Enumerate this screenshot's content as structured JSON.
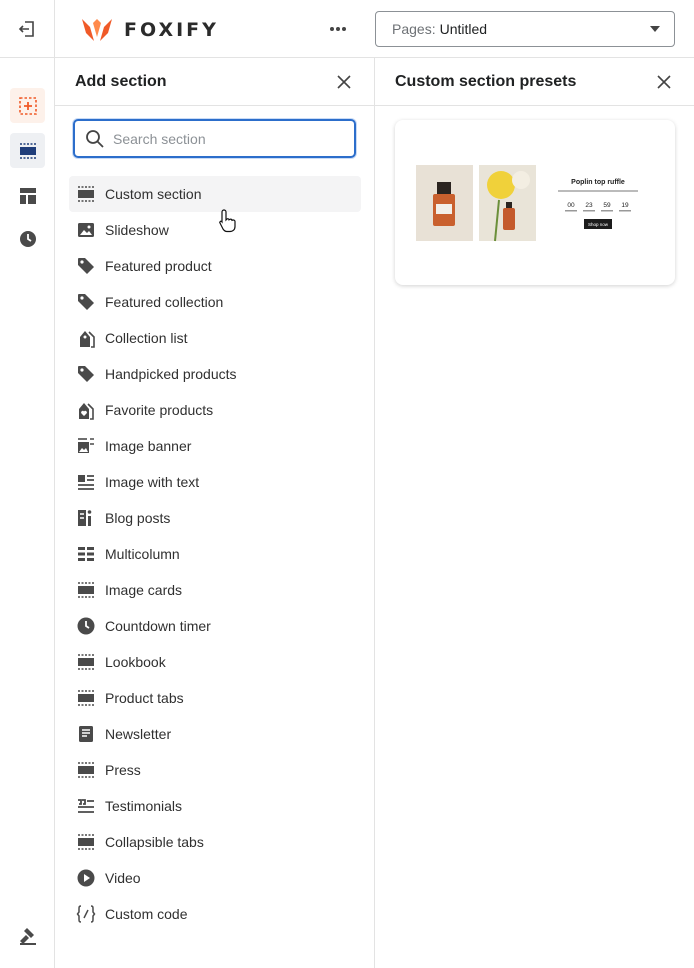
{
  "topbar": {
    "brand": "FOXIFY",
    "pages_prefix": "Pages:",
    "pages_value": "Untitled"
  },
  "rail": {
    "icons": [
      "add-section-icon",
      "section-icon",
      "layout-icon",
      "history-icon",
      "tools-icon"
    ]
  },
  "add_panel": {
    "title": "Add section",
    "search_placeholder": "Search section",
    "items": [
      {
        "label": "Custom section",
        "icon": "section-icon"
      },
      {
        "label": "Slideshow",
        "icon": "image-icon"
      },
      {
        "label": "Featured product",
        "icon": "tag-icon"
      },
      {
        "label": "Featured collection",
        "icon": "tag-icon"
      },
      {
        "label": "Collection list",
        "icon": "tags-icon"
      },
      {
        "label": "Handpicked products",
        "icon": "tag-icon"
      },
      {
        "label": "Favorite products",
        "icon": "heart-tag-icon"
      },
      {
        "label": "Image banner",
        "icon": "image-banner-icon"
      },
      {
        "label": "Image with text",
        "icon": "image-text-icon"
      },
      {
        "label": "Blog posts",
        "icon": "blog-icon"
      },
      {
        "label": "Multicolumn",
        "icon": "columns-icon"
      },
      {
        "label": "Image cards",
        "icon": "section-icon"
      },
      {
        "label": "Countdown timer",
        "icon": "clock-icon"
      },
      {
        "label": "Lookbook",
        "icon": "section-icon"
      },
      {
        "label": "Product tabs",
        "icon": "section-icon"
      },
      {
        "label": "Newsletter",
        "icon": "newsletter-icon"
      },
      {
        "label": "Press",
        "icon": "section-icon"
      },
      {
        "label": "Testimonials",
        "icon": "quote-icon"
      },
      {
        "label": "Collapsible tabs",
        "icon": "section-icon"
      },
      {
        "label": "Video",
        "icon": "play-icon"
      },
      {
        "label": "Custom code",
        "icon": "code-icon"
      }
    ]
  },
  "presets_panel": {
    "title": "Custom section presets",
    "preset": {
      "heading": "Poplin top ruffle",
      "timer": {
        "days": "00",
        "hours": "23",
        "mins": "59",
        "secs": "19"
      },
      "button": "Shop now"
    }
  },
  "colors": {
    "accent": "#f05a28",
    "focus": "#2c6ecb",
    "text": "#303030",
    "icon": "#4a4a4a"
  }
}
